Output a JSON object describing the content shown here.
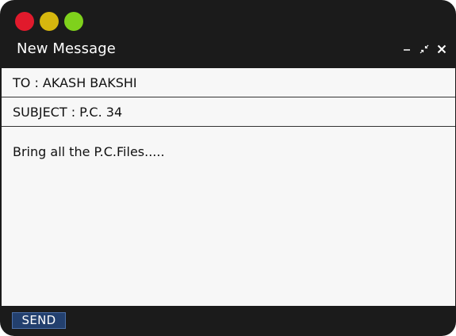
{
  "window": {
    "title": "New Message",
    "traffic_lights": [
      {
        "name": "close",
        "color": "#e11a2c"
      },
      {
        "name": "minimize",
        "color": "#d6b70e"
      },
      {
        "name": "maximize",
        "color": "#7fd11c"
      }
    ],
    "controls": [
      "minimize-icon",
      "collapse-icon",
      "close-icon"
    ]
  },
  "email": {
    "to_line": "TO : AKASH BAKSHI",
    "subject_line": "SUBJECT : P.C. 34",
    "body": "Bring all the P.C.Files....."
  },
  "footer": {
    "send_label": "SEND"
  },
  "colors": {
    "window_bg": "#1b1b1b",
    "content_bg": "#f7f7f7",
    "send_button": "#23406e"
  }
}
